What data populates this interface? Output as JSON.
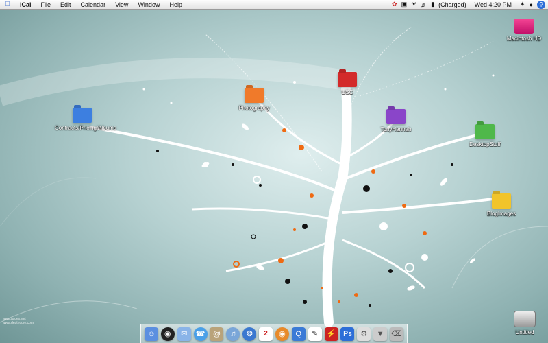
{
  "menubar": {
    "app_name": "iCal",
    "menus": [
      "File",
      "Edit",
      "Calendar",
      "View",
      "Window",
      "Help"
    ],
    "battery_status": "(Charged)",
    "clock": "Wed 4:20 PM"
  },
  "desktop_icons": {
    "contracts": "Contracts/Pricing/Albums",
    "photography": "Photography",
    "usc": "USC",
    "tonyhannah": "TonyHannah",
    "desktopstuff": "DesktopStuff",
    "blogimages": "BlogImages",
    "macintosh_hd": "Macintosh HD",
    "untitled": "Untitled"
  },
  "colors": {
    "contracts": "#3d7fe0",
    "photography": "#f07a2a",
    "usc": "#d32a2a",
    "tonyhannah": "#8a45c9",
    "desktopstuff": "#4fb84a",
    "blogimages": "#f2c42a",
    "macintosh_hd": "#e0207a",
    "accent_orange": "#ef6a12"
  },
  "dock": {
    "ical_date": "2",
    "items": [
      "finder-icon",
      "dashboard-icon",
      "mail-icon",
      "ichat-icon",
      "itunes-icon",
      "addressbook-icon",
      "ical-icon",
      "safari-icon",
      "firefox-icon",
      "photoshop-icon",
      "trash-icon"
    ]
  },
  "brand": {
    "line1": "www.asdex.net",
    "line2": "www.depthcore.com"
  }
}
